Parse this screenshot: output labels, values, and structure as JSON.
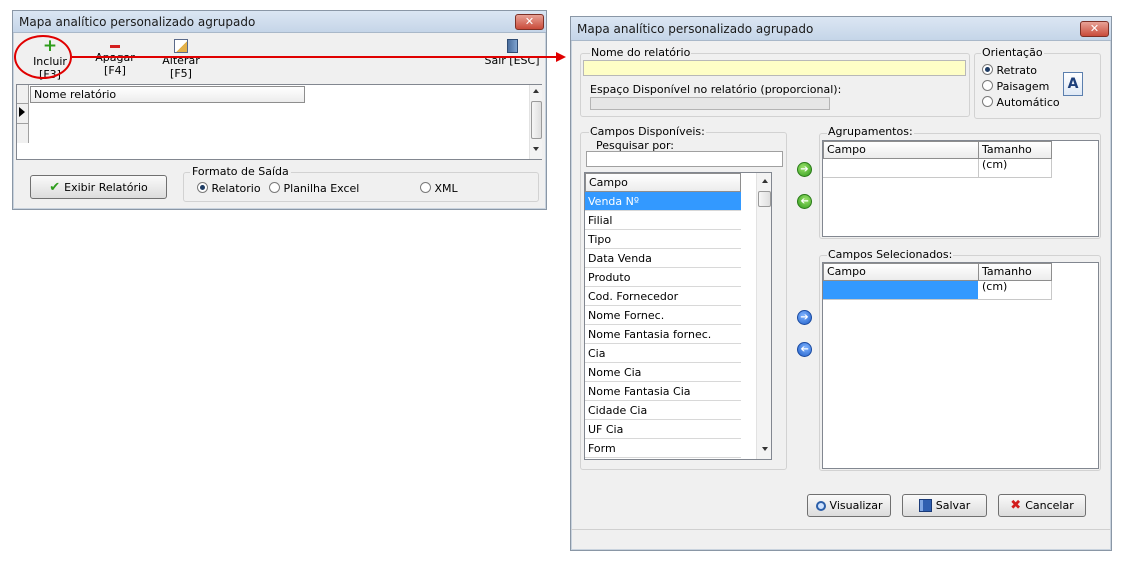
{
  "left_window": {
    "title": "Mapa analítico personalizado agrupado",
    "toolbar": {
      "incluir": "Incluir [F3]",
      "apagar": "Apagar [F4]",
      "alterar": "Alterar [F5]",
      "sair": "Sair [ESC]"
    },
    "grid": {
      "column": "Nome relatório"
    },
    "exibir_button": "Exibir Relatório",
    "formato": {
      "title": "Formato de Saída",
      "options": [
        "Relatorio",
        "Planilha Excel",
        "XML"
      ],
      "selected": "Relatorio"
    }
  },
  "right_window": {
    "title": "Mapa analítico personalizado agrupado",
    "nome_label": "Nome do relatório",
    "nome_value": "",
    "espaco_label": "Espaço Disponível no relatório (proporcional):",
    "orientacao": {
      "title": "Orientação",
      "options": [
        "Retrato",
        "Paisagem",
        "Automático"
      ],
      "selected": "Retrato"
    },
    "campos_disponiveis": {
      "title": "Campos Disponíveis:",
      "search_label": "Pesquisar por:",
      "column": "Campo",
      "items": [
        "Venda Nº",
        "Filial",
        "Tipo",
        "Data Venda",
        "Produto",
        "Cod. Fornecedor",
        "Nome Fornec.",
        "Nome Fantasia fornec.",
        "Cia",
        "Nome Cia",
        "Nome Fantasia Cia",
        "Cidade Cia",
        "UF Cia",
        "Form"
      ],
      "selected_index": 0
    },
    "agrupamentos": {
      "title": "Agrupamentos:",
      "col1": "Campo",
      "col2": "Tamanho (cm)"
    },
    "selecionados": {
      "title": "Campos Selecionados:",
      "col1": "Campo",
      "col2": "Tamanho (cm)"
    },
    "buttons": {
      "visualizar": "Visualizar",
      "salvar": "Salvar",
      "cancelar": "Cancelar"
    }
  },
  "colors": {
    "highlight": "#3399ff",
    "name_field": "#fefec6",
    "annotation": "#e00000"
  }
}
